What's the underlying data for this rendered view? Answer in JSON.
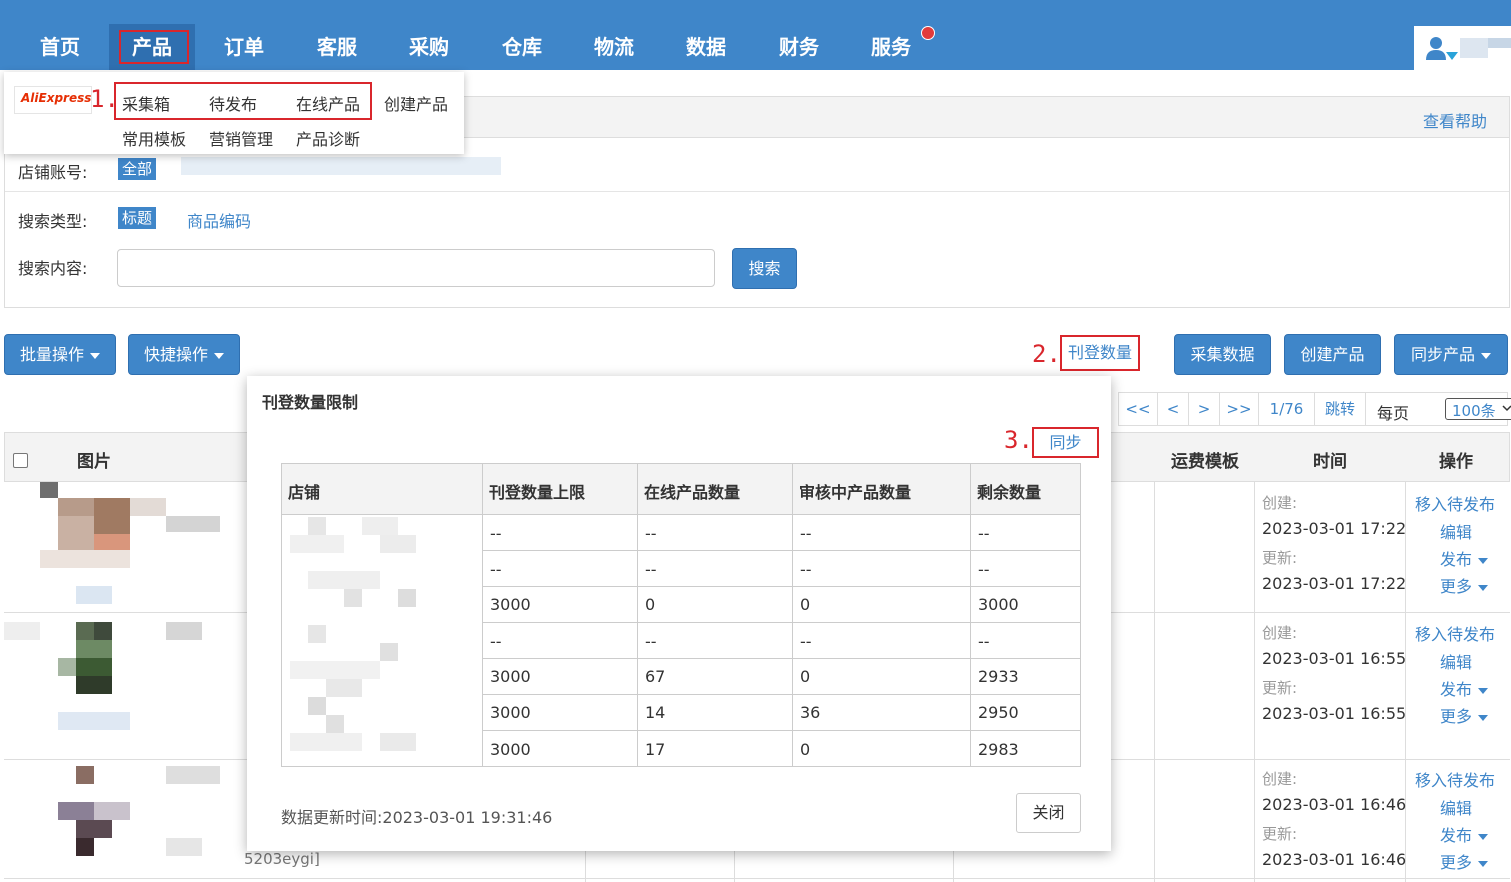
{
  "nav": {
    "items": [
      "首页",
      "产品",
      "订单",
      "客服",
      "采购",
      "仓库",
      "物流",
      "数据",
      "财务",
      "服务"
    ],
    "active_index": 1
  },
  "product_menu": {
    "brand_logo": "AliExpress",
    "step1": "1.",
    "row1": [
      "采集箱",
      "待发布",
      "在线产品",
      "创建产品"
    ],
    "row2": [
      "常用模板",
      "营销管理",
      "产品诊断"
    ]
  },
  "filter": {
    "help_link": "查看帮助",
    "store_label": "店铺账号:",
    "store_all": "全部",
    "search_type_label": "搜索类型:",
    "search_type_active": "标题",
    "search_type_other": "商品编码",
    "search_content_label": "搜索内容:",
    "search_input_value": "",
    "search_button": "搜索"
  },
  "toolbar": {
    "batch_ops": "批量操作",
    "quick_ops": "快捷操作",
    "step2": "2.",
    "listing_count": "刊登数量",
    "collect_data": "采集数据",
    "create_product": "创建产品",
    "sync_product": "同步产品"
  },
  "pager": {
    "first": "<<",
    "prev": "<",
    "next": ">",
    "last": ">>",
    "page": "1/76",
    "jump": "跳转",
    "per_page_label": "每页",
    "per_page_value": "100条"
  },
  "table": {
    "headers": {
      "image": "图片",
      "shipping": "运费模板",
      "time": "时间",
      "ops": "操作"
    },
    "rows": [
      {
        "created_label": "创建:",
        "created": "2023-03-01 17:22",
        "updated_label": "更新:",
        "updated": "2023-03-01 17:22"
      },
      {
        "created_label": "创建:",
        "created": "2023-03-01 16:55",
        "updated_label": "更新:",
        "updated": "2023-03-01 16:55"
      },
      {
        "created_label": "创建:",
        "created": "2023-03-01 16:46",
        "updated_label": "更新:",
        "updated": "2023-03-01 16:46"
      }
    ],
    "ops": {
      "move": "移入待发布",
      "edit": "编辑",
      "publish": "发布",
      "more": "更多"
    },
    "partial_text": "5203eygi]"
  },
  "modal": {
    "title": "刊登数量限制",
    "step3": "3.",
    "sync_button": "同步",
    "headers": [
      "店铺",
      "刊登数量上限",
      "在线产品数量",
      "审核中产品数量",
      "剩余数量"
    ],
    "rows": [
      [
        "--",
        "--",
        "--",
        "--"
      ],
      [
        "--",
        "--",
        "--",
        "--"
      ],
      [
        "3000",
        "0",
        "0",
        "3000"
      ],
      [
        "--",
        "--",
        "--",
        "--"
      ],
      [
        "3000",
        "67",
        "0",
        "2933"
      ],
      [
        "3000",
        "14",
        "36",
        "2950"
      ],
      [
        "3000",
        "17",
        "0",
        "2983"
      ]
    ],
    "update_time": "数据更新时间:2023-03-01 19:31:46",
    "close_button": "关闭"
  },
  "colors": {
    "brand_blue": "#3f86c9",
    "highlight_red": "#d9262c"
  }
}
